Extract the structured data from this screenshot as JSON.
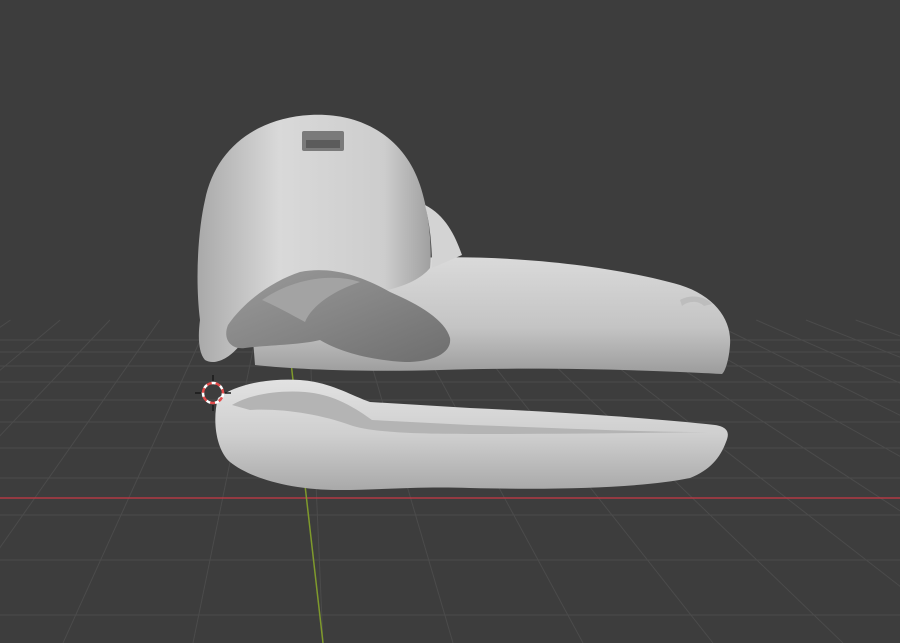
{
  "viewport": {
    "background_color": "#3d3d3d",
    "grid_color": "#4a4a4a",
    "x_axis_color": "#b23a45",
    "y_axis_color": "#7f9a2c",
    "cursor_colors": [
      "#e34a4a",
      "#ffffff"
    ]
  },
  "scene": {
    "objects": [
      {
        "name": "beak-upper-head",
        "color": "#c6c6c6"
      },
      {
        "name": "eyebrow-flap",
        "color": "#8a8a8a"
      },
      {
        "name": "beak-lower-jaw",
        "color": "#cfcfcf"
      }
    ],
    "cursor_icon": "3d-cursor-icon"
  }
}
